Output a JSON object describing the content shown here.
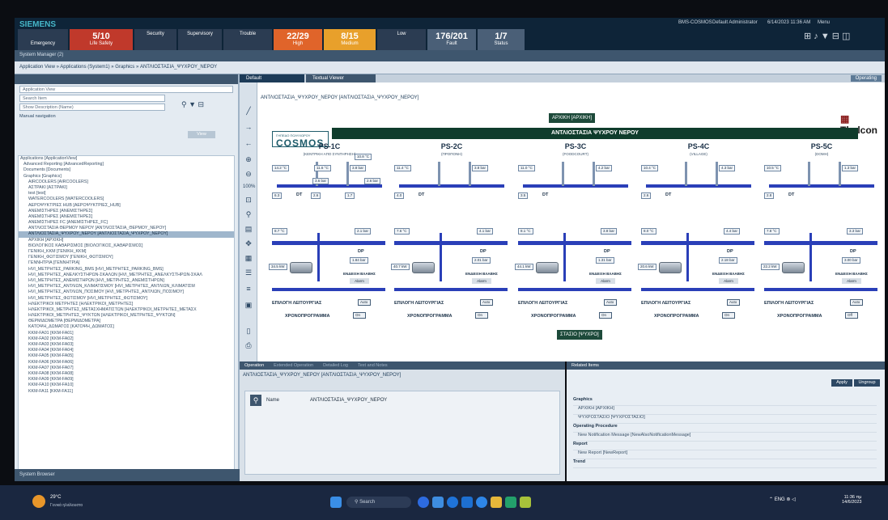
{
  "app": {
    "brand": "SIEMENS",
    "server": "BMS-COSMOS",
    "user": "Default Administrator",
    "datetime": "6/14/2023 11:36 AM",
    "menu": "Menu",
    "window_title": "System Manager (2)"
  },
  "summary": [
    {
      "count": "5/10",
      "label": "Life Safety",
      "color": "#c0392b"
    },
    {
      "count": "",
      "label": "Security",
      "color": "#2b3c52"
    },
    {
      "count": "",
      "label": "Supervisory",
      "color": "#2b3c52"
    },
    {
      "count": "",
      "label": "Trouble",
      "color": "#2b3c52"
    },
    {
      "count": "22/29",
      "label": "High",
      "color": "#e0642a"
    },
    {
      "count": "8/15",
      "label": "Medium",
      "color": "#e8a02b"
    },
    {
      "count": "",
      "label": "Low",
      "color": "#2b3c52"
    },
    {
      "count": "176/201",
      "label": "Fault",
      "color": "#4a5f77"
    },
    {
      "count": "1/7",
      "label": "Status",
      "color": "#4a5f77"
    }
  ],
  "emergency_label": "Emergency",
  "breadcrumb": "Application View » Applications (System1) » Graphics » ΑΝΤΛΙΟΣΤΑΣΙΑ_ΨΥΧΡΟΥ_ΝΕΡΟΥ",
  "left_panel": {
    "view_label": "Application View",
    "search_placeholder": "Search Item",
    "show_label": "Show Description (Name)",
    "manual_nav": "Manual navigation",
    "view_btn": "View",
    "tree": [
      {
        "text": "Applications [ApplicationView]",
        "indent": 0,
        "selected": false
      },
      {
        "text": "Advanced Reporting [AdvancedReporting]",
        "indent": 1,
        "selected": false
      },
      {
        "text": "Documents [Documents]",
        "indent": 1,
        "selected": false
      },
      {
        "text": "Graphics [Graphics]",
        "indent": 1,
        "selected": false
      },
      {
        "text": "AIRCOOLERS [AIRCOOLERS]",
        "indent": 2,
        "selected": false
      },
      {
        "text": "ΑΣΤΡΑΚΙ [ΑΣΤΡΑΚΙ]",
        "indent": 2,
        "selected": false
      },
      {
        "text": "test [test]",
        "indent": 2,
        "selected": false
      },
      {
        "text": "WATERCOOLERS [WATERCOOLERS]",
        "indent": 2,
        "selected": false
      },
      {
        "text": "ΑΕΡΟΨΥΚΤΡΙΕΣ HUB [ΑΕΡΟΨΥΚΤΡΙΕΣ_HUB]",
        "indent": 2,
        "selected": false
      },
      {
        "text": "ΑΝΕΜΙΣΤΗΡΕΣ [ΑΝΕΜΙΣΤΗΡΕΣ]",
        "indent": 2,
        "selected": false
      },
      {
        "text": "ΑΝΕΜΙΣΤΗΡΕΣ [ΑΝΕΜΙΣΤΗΡΕΣ]",
        "indent": 2,
        "selected": false
      },
      {
        "text": "ΑΝΕΜΙΣΤΗΡΕΣ FC [ΑΝΕΜΙΣΤΗΡΕΣ_FC]",
        "indent": 2,
        "selected": false
      },
      {
        "text": "ΑΝΤΛΙΟΣΤΑΣΙΑ ΘΕΡΜΟΥ ΝΕΡΟΥ [ΑΝΤΛΙΟΣΤΑΣΙΑ_ΘΕΡΜΟΥ_ΝΕΡΟΥ]",
        "indent": 2,
        "selected": false
      },
      {
        "text": "ΑΝΤΛΙΟΣΤΑΣΙΑ_ΨΥΧΡΟΥ_ΝΕΡΟΥ [ΑΝΤΛΙΟΣΤΑΣΙΑ_ΨΥΧΡΟΥ_ΝΕΡΟΥ]",
        "indent": 2,
        "selected": true
      },
      {
        "text": "ΑΡΧΙΚΗ [ΑΡΧΙΚΗ]",
        "indent": 2,
        "selected": false
      },
      {
        "text": "ΒΙΟΛΟΓΙΚΟΣ ΚΑΘΑΡΙΣΜΟΣ [ΒΙΟΛΟΓΙΚΟΣ_ΚΑΘΑΡΙΣΜΟΣ]",
        "indent": 2,
        "selected": false
      },
      {
        "text": "ΓΕΝΙΚΗ_ΚΚΜ [ΓΕΝΙΚΗ_ΚΚΜ]",
        "indent": 2,
        "selected": false
      },
      {
        "text": "ΓΕΝΙΚΗ_ΦΩΤΙΣΜΟΥ [ΓΕΝΙΚΗ_ΦΩΤΙΣΜΟΥ]",
        "indent": 2,
        "selected": false
      },
      {
        "text": "ΓΕΝΝΗΤΡΙΑ [ΓΕΝΝΗΤΡΙΑ]",
        "indent": 2,
        "selected": false
      },
      {
        "text": "HVI_ΜΕΤΡΗΤΕΣ_PARKING_BMS [HVI_ΜΕΤΡΗΤΕΣ_PARKING_BMS]",
        "indent": 2,
        "selected": false
      },
      {
        "text": "HVI_ΜΕΤΡΗΤΕΣ_ΑΝΕΛΚΥΣΤΗΡΩΝ-ΣΚΑΛΩΝ [HVI_ΜΕΤΡΗΤΕΣ_ΑΝΕΛΚΥΣΤΗΡΩΝ-ΣΚΑΛ",
        "indent": 2,
        "selected": false
      },
      {
        "text": "HVI_ΜΕΤΡΗΤΕΣ_ΑΝΕΜΙΣΤΗΡΩΝ [HVI_ΜΕΤΡΗΤΕΣ_ΑΝΕΜΙΣΤΗΡΩΝ]",
        "indent": 2,
        "selected": false
      },
      {
        "text": "HVI_ΜΕΤΡΗΤΕΣ_ΑΝΤΛΙΩΝ_ΚΛΙΜΑΤΙΣΜΟΥ [HVI_ΜΕΤΡΗΤΕΣ_ΑΝΤΛΙΩΝ_ΚΛΙΜΑΤΙΣΜ",
        "indent": 2,
        "selected": false
      },
      {
        "text": "HVI_ΜΕΤΡΗΤΕΣ_ΑΝΤΛΙΩΝ_ΠΟΣΙΜΟΥ [HVI_ΜΕΤΡΗΤΕΣ_ΑΝΤΛΙΩΝ_ΠΟΣΙΜΟΥ]",
        "indent": 2,
        "selected": false
      },
      {
        "text": "HVI_ΜΕΤΡΗΤΕΣ_ΦΩΤΙΣΜΟΥ [HVI_ΜΕΤΡΗΤΕΣ_ΦΩΤΙΣΜΟΥ]",
        "indent": 2,
        "selected": false
      },
      {
        "text": "ΗΛΕΚΤΡΙΚΟΙ ΜΕΤΡΗΤΕΣ [ΗΛΕΚΤΡΙΚΟΙ_ΜΕΤΡΗΤΕΣ]",
        "indent": 2,
        "selected": false
      },
      {
        "text": "ΗΛΕΚΤΡΙΚΟΙ_ΜΕΤΡΗΤΕΣ_ΜΕΤΑΣΧΗΜΑΤΙΣΤΩΝ [ΗΛΕΚΤΡΙΚΟΙ_ΜΕΤΡΗΤΕΣ_ΜΕΤΑΣΧ",
        "indent": 2,
        "selected": false
      },
      {
        "text": "ΗΛΕΚΤΡΙΚΟΙ_ΜΕΤΡΗΤΕΣ_ΨΥΚΤΩΝ [ΗΛΕΚΤΡΙΚΟΙ_ΜΕΤΡΗΤΕΣ_ΨΥΚΤΩΝ]",
        "indent": 2,
        "selected": false
      },
      {
        "text": "ΘΕΡΜΙΔΟΜΕΤΡΑ [ΘΕΡΜΙΔΟΜΕΤΡΑ]",
        "indent": 2,
        "selected": false
      },
      {
        "text": "ΚΑΤΟΨΗ_ΔΩΜΑΤΟΣ [ΚΑΤΟΨΗ_ΔΩΜΑΤΟΣ]",
        "indent": 2,
        "selected": false
      },
      {
        "text": "ΚΚΜ-FA01 [ΚΚΜ-FA01]",
        "indent": 2,
        "selected": false
      },
      {
        "text": "ΚΚΜ-FA02 [ΚΚΜ-FA02]",
        "indent": 2,
        "selected": false
      },
      {
        "text": "ΚΚΜ-FA03 [ΚΚΜ-FA03]",
        "indent": 2,
        "selected": false
      },
      {
        "text": "ΚΚΜ-FA04 [ΚΚΜ-FA04]",
        "indent": 2,
        "selected": false
      },
      {
        "text": "ΚΚΜ-FA05 [ΚΚΜ-FA05]",
        "indent": 2,
        "selected": false
      },
      {
        "text": "ΚΚΜ-FA06 [ΚΚΜ-FA06]",
        "indent": 2,
        "selected": false
      },
      {
        "text": "ΚΚΜ-FA07 [ΚΚΜ-FA07]",
        "indent": 2,
        "selected": false
      },
      {
        "text": "ΚΚΜ-FA08 [ΚΚΜ-FA08]",
        "indent": 2,
        "selected": false
      },
      {
        "text": "ΚΚΜ-FA09 [ΚΚΜ-FA09]",
        "indent": 2,
        "selected": false
      },
      {
        "text": "ΚΚΜ-FA10 [ΚΚΜ-FA10]",
        "indent": 2,
        "selected": false
      },
      {
        "text": "ΚΚΜ-FA11 [ΚΚΜ-FA11]",
        "indent": 2,
        "selected": false
      }
    ],
    "footer": "System Browser"
  },
  "tabs": {
    "default": "Default",
    "textual": "Textual Viewer",
    "operating": "Operating"
  },
  "graphic": {
    "path": "ΑΝΤΛΙΟΣΤΑΣΙΑ_ΨΥΧΡΟΥ_ΝΕΡΟΥ [ΑΝΤΛΙΟΣΤΑΣΙΑ_ΨΥΧΡΟΥ_ΝΕΡΟΥ]",
    "logo_small": "ΓΗΠΕΔΟ ΠΟΛΥΧΩΡΟΥ",
    "logo": "COSMOS",
    "home": "ΑΡΧΙΚΗ [ΑΡΧΙΚΗ]",
    "banner": "ΑΝΤΛΙΟΣΤΑΣΙΑ ΨΥΧΡΟΥ ΝΕΡΟΥ",
    "thelcon": "Thelcon",
    "station_btn": "ΣΤΑΣΙΟ [ΨΥΧΡΟ]",
    "stations": [
      {
        "name": "PS-1C",
        "sub": "(ΚΕΝΤΡΙΚΗ ΑΠΟ ΣΥΝΤΗΡΗΣΗ)",
        "t1": "14.2 °C",
        "t2": "11.6 °C",
        "t3": "10.8 °C",
        "p1": "3.8 bar",
        "p2": "3.6 bar",
        "p3": "2.6 bar",
        "dt": "DT",
        "d1": "6.3",
        "d2": "2.6",
        "d3": "1.7",
        "t4": "8.7 °C",
        "p4": "2.1 bar",
        "pw": "34.5 kW",
        "dp": "DP",
        "dpv": "1.84 bar",
        "ena": "ΕΝΔΕΙΞΗ ΒΛΑΒΗΣ",
        "alarm": "Alarm",
        "mode": "ΕΠΙΛΟΓΗ ΛΕΙΤΟΥΡΓΙΑΣ",
        "mode_v": "Auto",
        "prog": "ΧΡΟΝΟΠΡΟΓΡΑΜΜΑ",
        "prog_v": "On"
      },
      {
        "name": "PS-2C",
        "sub": "(ΠΡΟΠΟΝΗ)",
        "t1": "11.4 °C",
        "t2": "",
        "t3": "",
        "p1": "3.8 bar",
        "p2": "",
        "p3": "",
        "dt": "DT",
        "d1": "4.0",
        "d2": "",
        "d3": "",
        "t4": "7.6 °C",
        "p4": "4.1 bar",
        "pw": "40.7 kW",
        "dp": "DP",
        "dpv": "2.01 bar",
        "ena": "ΕΝΔΕΙΞΗ ΒΛΑΒΗΣ",
        "alarm": "Alarm",
        "mode": "ΕΠΙΛΟΓΗ ΛΕΙΤΟΥΡΓΙΑΣ",
        "mode_v": "Auto",
        "prog": "ΧΡΟΝΟΠΡΟΓΡΑΜΜΑ",
        "prog_v": "On"
      },
      {
        "name": "PS-3C",
        "sub": "(FOODCOURT)",
        "t1": "11.0 °C",
        "t2": "",
        "t3": "",
        "p1": "4.2 bar",
        "p2": "",
        "p3": "",
        "dt": "DT",
        "d1": "3.5",
        "d2": "",
        "d3": "",
        "t4": "8.1 °C",
        "p4": "3.8 bar",
        "pw": "44.1 kW",
        "dp": "DP",
        "dpv": "1.31 bar",
        "ena": "ΕΝΔΕΙΞΗ ΒΛΑΒΗΣ",
        "alarm": "Alarm",
        "mode": "ΕΠΙΛΟΓΗ ΛΕΙΤΟΥΡΓΙΑΣ",
        "mode_v": "Auto",
        "prog": "ΧΡΟΝΟΠΡΟΓΡΑΜΜΑ",
        "prog_v": "On"
      },
      {
        "name": "PS-4C",
        "sub": "(VILLAGE)",
        "t1": "10.4 °C",
        "t2": "",
        "t3": "",
        "p1": "4.3 bar",
        "p2": "",
        "p3": "",
        "dt": "DT",
        "d1": "2.6",
        "d2": "",
        "d3": "",
        "t4": "8.0 °C",
        "p4": "4.4 bar",
        "pw": "20.6 kW",
        "dp": "DP",
        "dpv": "2.18 bar",
        "ena": "ΕΝΔΕΙΞΗ ΒΛΑΒΗΣ",
        "alarm": "Alarm",
        "mode": "ΕΠΙΛΟΓΗ ΛΕΙΤΟΥΡΓΙΑΣ",
        "mode_v": "Auto",
        "prog": "ΧΡΟΝΟΠΡΟΓΡΑΜΜΑ",
        "prog_v": "On"
      },
      {
        "name": "PS-5C",
        "sub": "(DOMH)",
        "t1": "10.5 °C",
        "t2": "",
        "t3": "",
        "p1": "1.3 bar",
        "p2": "",
        "p3": "",
        "dt": "DT",
        "d1": "2.8",
        "d2": "",
        "d3": "",
        "t4": "7.8 °C",
        "p4": "3.3 bar",
        "pw": "22.2 kW",
        "dp": "DP",
        "dpv": "3.00 bar",
        "ena": "ΕΝΔΕΙΞΗ ΒΛΑΒΗΣ",
        "alarm": "Alarm",
        "mode": "ΕΠΙΛΟΓΗ ΛΕΙΤΟΥΡΓΙΑΣ",
        "mode_v": "Auto",
        "prog": "ΧΡΟΝΟΠΡΟΓΡΑΜΜΑ",
        "prog_v": "Off"
      }
    ]
  },
  "operation": {
    "tabs": [
      "Operation",
      "Extended Operation",
      "Detailed Log",
      "Text and Notes"
    ],
    "path": "ΑΝΤΛΙΟΣΤΑΣΙΑ_ΨΥΧΡΟΥ_ΝΕΡΟΥ [ΑΝΤΛΙΟΣΤΑΣΙΑ_ΨΥΧΡΟΥ_ΝΕΡΟΥ]",
    "name_label": "Name",
    "name_value": "ΑΝΤΛΙΟΣΤΑΣΙΑ_ΨΥΧΡΟΥ_ΝΕΡΟΥ"
  },
  "related": {
    "title": "Related Items",
    "btn_apply": "Apply",
    "btn_ungroup": "Ungroup",
    "items": [
      {
        "text": "Graphics",
        "head": true
      },
      {
        "text": "ΑΡΧΙΚΗ [ΑΡΧΙΚΗ]",
        "head": false
      },
      {
        "text": "ΨΥΧΡΟΣΤΑΣΙΟ [ΨΥΧΡΟΣΤΑΣΙΟ]",
        "head": false
      },
      {
        "text": "Operating Procedure",
        "head": true
      },
      {
        "text": "New Notification Message [NewAlsoNotificationMessage]",
        "head": false
      },
      {
        "text": "Report",
        "head": true
      },
      {
        "text": "New Report [NewReport]",
        "head": false
      },
      {
        "text": "Trend",
        "head": true
      }
    ]
  },
  "taskbar": {
    "temp": "29°C",
    "weather": "Γενικά ηλιόλουστο",
    "search": "Search",
    "lang": "ENG",
    "time": "11:36 πμ",
    "date": "14/6/2023"
  }
}
